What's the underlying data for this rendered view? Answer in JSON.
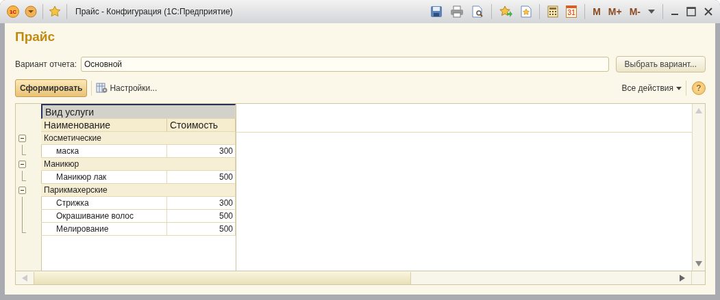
{
  "window": {
    "logo": "1С",
    "title": "Прайс - Конфигурация  (1С:Предприятие)",
    "calendar_day": "31",
    "memory_buttons": [
      "M",
      "M+",
      "M-"
    ]
  },
  "heading": "Прайс",
  "variant": {
    "label": "Вариант отчета:",
    "value": "Основной",
    "button": "Выбрать вариант..."
  },
  "toolbar": {
    "generate": "Сформировать",
    "settings": "Настройки...",
    "all_actions": "Все действия",
    "help": "?"
  },
  "report": {
    "group_header": "Вид услуги",
    "columns": [
      "Наименование",
      "Стоимость"
    ],
    "groups": [
      {
        "name": "Косметические",
        "expanded": true,
        "children": [
          {
            "name": "маска",
            "cost": "300"
          }
        ]
      },
      {
        "name": "Маникюр",
        "expanded": true,
        "children": [
          {
            "name": "Маникюр лак",
            "cost": "500"
          }
        ]
      },
      {
        "name": "Парикмахерские",
        "expanded": true,
        "children": [
          {
            "name": "Стрижка",
            "cost": "300"
          },
          {
            "name": "Окрашивание волос",
            "cost": "500"
          },
          {
            "name": "Мелирование",
            "cost": "500"
          }
        ]
      }
    ]
  }
}
